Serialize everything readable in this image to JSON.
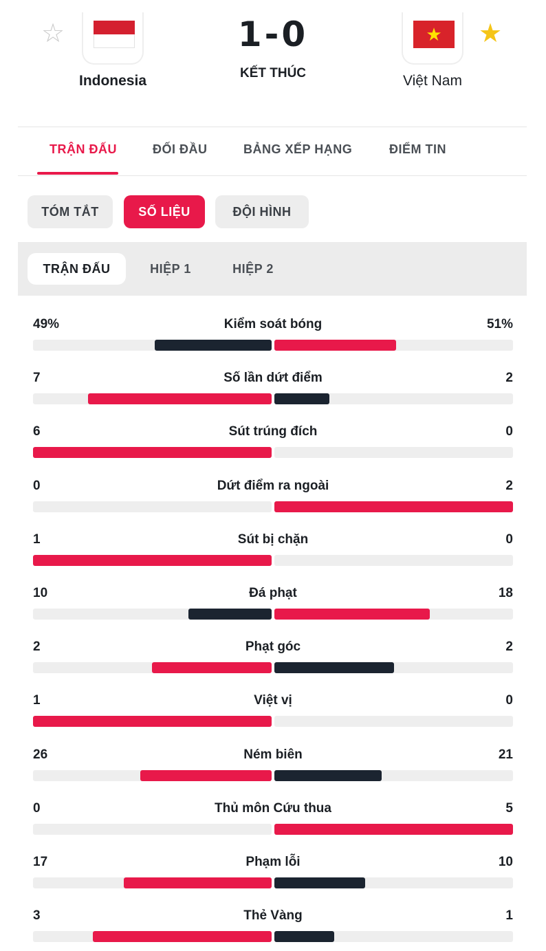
{
  "match": {
    "home_team": "Indonesia",
    "away_team": "Việt Nam",
    "score": "1-0",
    "status": "KẾT THÚC",
    "home_favorite_icon": "star-outline-icon",
    "away_favorite_icon": "star-filled-icon"
  },
  "main_tabs": [
    {
      "label": "TRẬN ĐẤU",
      "active": true
    },
    {
      "label": "ĐỐI ĐẦU",
      "active": false
    },
    {
      "label": "BẢNG XẾP HẠNG",
      "active": false
    },
    {
      "label": "ĐIỂM TIN",
      "active": false
    }
  ],
  "sub_tabs": [
    {
      "label": "TÓM TẮT",
      "active": false
    },
    {
      "label": "SỐ LIỆU",
      "active": true
    },
    {
      "label": "ĐỘI HÌNH",
      "active": false
    }
  ],
  "period_tabs": [
    {
      "label": "TRẬN ĐẤU",
      "active": true
    },
    {
      "label": "HIỆP 1",
      "active": false
    },
    {
      "label": "HIỆP 2",
      "active": false
    }
  ],
  "colors": {
    "accent": "#e8194a",
    "dark_bar": "#1b2430",
    "track": "#eeeeee"
  },
  "stats": [
    {
      "label": "Kiểm soát bóng",
      "home": "49%",
      "away": "51%",
      "home_value": 49,
      "away_value": 51,
      "home_fill": 0.49,
      "away_fill": 0.51
    },
    {
      "label": "Số lần dứt điểm",
      "home": "7",
      "away": "2",
      "home_value": 7,
      "away_value": 2,
      "home_fill": 0.77,
      "away_fill": 0.23
    },
    {
      "label": "Sút trúng đích",
      "home": "6",
      "away": "0",
      "home_value": 6,
      "away_value": 0,
      "home_fill": 1.0,
      "away_fill": 0
    },
    {
      "label": "Dứt điểm ra ngoài",
      "home": "0",
      "away": "2",
      "home_value": 0,
      "away_value": 2,
      "home_fill": 0,
      "away_fill": 1.0
    },
    {
      "label": "Sút bị chặn",
      "home": "1",
      "away": "0",
      "home_value": 1,
      "away_value": 0,
      "home_fill": 1.0,
      "away_fill": 0
    },
    {
      "label": "Đá phạt",
      "home": "10",
      "away": "18",
      "home_value": 10,
      "away_value": 18,
      "home_fill": 0.35,
      "away_fill": 0.65
    },
    {
      "label": "Phạt góc",
      "home": "2",
      "away": "2",
      "home_value": 2,
      "away_value": 2,
      "home_fill": 0.5,
      "away_fill": 0.5
    },
    {
      "label": "Việt vị",
      "home": "1",
      "away": "0",
      "home_value": 1,
      "away_value": 0,
      "home_fill": 1.0,
      "away_fill": 0
    },
    {
      "label": "Ném biên",
      "home": "26",
      "away": "21",
      "home_value": 26,
      "away_value": 21,
      "home_fill": 0.55,
      "away_fill": 0.45
    },
    {
      "label": "Thủ môn Cứu thua",
      "home": "0",
      "away": "5",
      "home_value": 0,
      "away_value": 5,
      "home_fill": 0,
      "away_fill": 1.0
    },
    {
      "label": "Phạm lỗi",
      "home": "17",
      "away": "10",
      "home_value": 17,
      "away_value": 10,
      "home_fill": 0.62,
      "away_fill": 0.38
    },
    {
      "label": "Thẻ Vàng",
      "home": "3",
      "away": "1",
      "home_value": 3,
      "away_value": 1,
      "home_fill": 0.75,
      "away_fill": 0.25
    }
  ]
}
